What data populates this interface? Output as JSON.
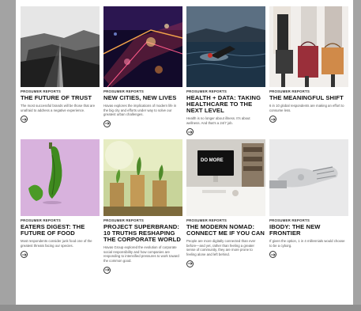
{
  "cards": [
    {
      "kicker": "PROSUMER REPORTS",
      "title": "THE FUTURE OF TRUST",
      "desc": "The most successful brands will be those that are unafraid to address a negative experience.",
      "arrow_icon": "arrow-right-icon"
    },
    {
      "kicker": "PROSUMER REPORTS",
      "title": "NEW CITIES, NEW LIVES",
      "desc": "Havas explores the implications of modern life in the big city and efforts under way to solve our greatest urban challenges.",
      "arrow_icon": "arrow-right-icon"
    },
    {
      "kicker": "PROSUMER REPORTS",
      "title": "HEALTH + DATA: TAKING HEALTHCARE TO THE NEXT LEVEL",
      "desc": "Health is no longer about illness. It's about wellness. And that's a 24/7 job.",
      "arrow_icon": "arrow-right-icon"
    },
    {
      "kicker": "PROSUMER REPORTS",
      "title": "THE MEANINGFUL SHIFT",
      "desc": "6 in 10 global respondents are making an effort to consume less.",
      "arrow_icon": "arrow-right-icon"
    },
    {
      "kicker": "PROSUMER REPORTS",
      "title": "EATERS DIGEST: THE FUTURE OF FOOD",
      "desc": "Most respondents consider junk food one of the greatest threats facing our species.",
      "arrow_icon": "arrow-right-icon"
    },
    {
      "kicker": "PROSUMER REPORTS",
      "title": "PROJECT SUPERBRAND: 10 TRUTHS RESHAPING THE CORPORATE WORLD",
      "desc": "Havas Group explored the evolution of corporate social responsibility and how companies are responding to intensified pressures to work toward the common good.",
      "arrow_icon": "arrow-right-icon"
    },
    {
      "kicker": "PROSUMER REPORTS",
      "title": "THE MODERN NOMAD: CONNECT ME IF YOU CAN",
      "desc": "People are more digitally connected than ever before—and yet, rather than feeling a greater sense of community, they are more prone to feeling alone and left behind.",
      "arrow_icon": "arrow-right-icon"
    },
    {
      "kicker": "PROSUMER REPORTS",
      "title": "IBODY: THE NEW FRONTIER",
      "desc": "If given the option, 1 in 4 millennials would choose to be a cyborg.",
      "arrow_icon": "arrow-right-icon"
    }
  ],
  "image_labels": {
    "monitor_text": "DO MORE"
  }
}
